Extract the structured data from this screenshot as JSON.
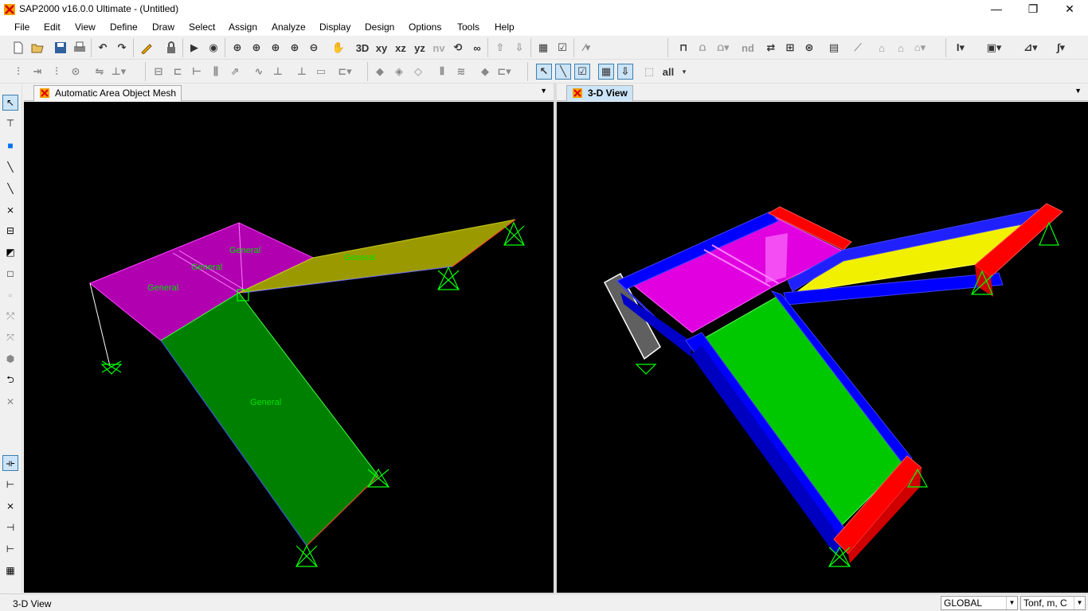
{
  "titlebar": {
    "title": "SAP2000 v16.0.0 Ultimate  - (Untitled)",
    "minimize": "—",
    "maximize": "❐",
    "close": "✕"
  },
  "menu": [
    "File",
    "Edit",
    "View",
    "Define",
    "Draw",
    "Select",
    "Assign",
    "Analyze",
    "Display",
    "Design",
    "Options",
    "Tools",
    "Help"
  ],
  "toolbar1_text": {
    "xy": "xy",
    "xz": "xz",
    "yz": "yz",
    "nv": "nv",
    "nd": "nd"
  },
  "toolbar2_text": {
    "all": "all"
  },
  "panes": {
    "left": {
      "tab_title": "Automatic Area Object Mesh",
      "labels": [
        "General",
        "General",
        "General",
        "General",
        "General"
      ]
    },
    "right": {
      "tab_title": "3-D View"
    }
  },
  "status": {
    "text": "3-D View",
    "coord_system": "GLOBAL",
    "units": "Tonf, m, C"
  },
  "colors": {
    "magenta": "#c000c0",
    "olive": "#9a9a00",
    "green": "#008800",
    "bright_green": "#00c800",
    "blue": "#0000ff",
    "red": "#ff0000",
    "support": "#00ff00"
  }
}
